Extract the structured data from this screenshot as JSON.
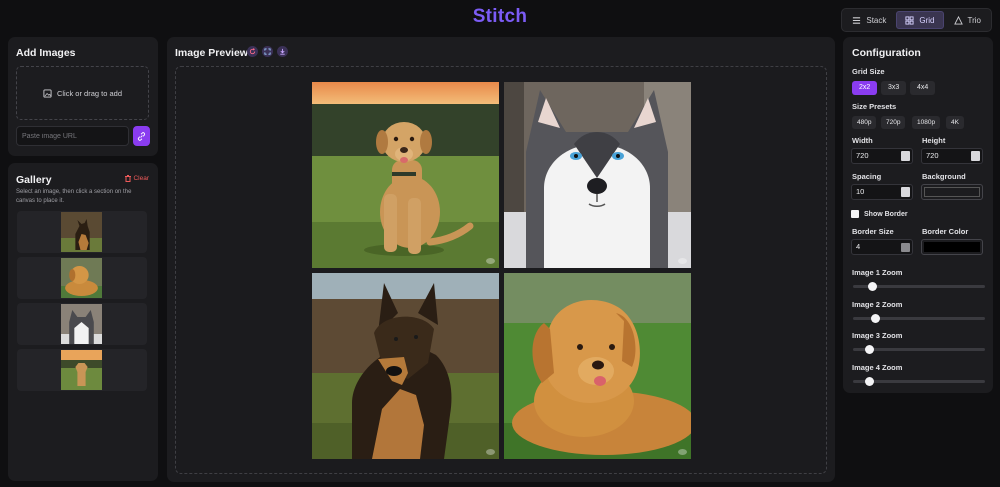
{
  "app": {
    "title": "Stitch"
  },
  "modes": [
    {
      "label": "Stack",
      "icon": "stack-icon",
      "active": false
    },
    {
      "label": "Grid",
      "icon": "grid-icon",
      "active": true
    },
    {
      "label": "Trio",
      "icon": "triangle-icon",
      "active": false
    }
  ],
  "add_images": {
    "title": "Add Images",
    "dropzone_label": "Click or drag to add",
    "url_placeholder": "Paste image URL",
    "url_value": ""
  },
  "gallery": {
    "title": "Gallery",
    "clear_label": "Clear",
    "hint": "Select an image, then click a section on the canvas to place it.",
    "items": [
      {
        "subject": "german-shepherd"
      },
      {
        "subject": "golden-retriever"
      },
      {
        "subject": "husky"
      },
      {
        "subject": "labrador"
      }
    ]
  },
  "preview": {
    "title": "Image Preview",
    "tools": [
      "reset-icon",
      "fullscreen-icon",
      "download-icon"
    ],
    "cells": [
      {
        "subject": "labrador"
      },
      {
        "subject": "husky"
      },
      {
        "subject": "german-shepherd"
      },
      {
        "subject": "golden-retriever"
      }
    ]
  },
  "config": {
    "title": "Configuration",
    "grid_size_label": "Grid Size",
    "grid_sizes": [
      "2x2",
      "3x3",
      "4x4"
    ],
    "grid_size_selected": "2x2",
    "presets_label": "Size Presets",
    "presets": [
      "480p",
      "720p",
      "1080p",
      "4K"
    ],
    "width_label": "Width",
    "width_value": "720",
    "height_label": "Height",
    "height_value": "720",
    "spacing_label": "Spacing",
    "spacing_value": "10",
    "background_label": "Background",
    "background_color": "#1c1c1f",
    "show_border_label": "Show Border",
    "show_border": false,
    "border_size_label": "Border Size",
    "border_size_value": "4",
    "border_color_label": "Border Color",
    "border_color": "#000000",
    "zooms": [
      {
        "label": "Image 1 Zoom",
        "value": 0.12
      },
      {
        "label": "Image 2 Zoom",
        "value": 0.15
      },
      {
        "label": "Image 3 Zoom",
        "value": 0.1
      },
      {
        "label": "Image 4 Zoom",
        "value": 0.1
      }
    ]
  },
  "colors": {
    "accent": "#8a3cf0",
    "brand": "#7c5cf5",
    "danger": "#ef5a5a"
  }
}
